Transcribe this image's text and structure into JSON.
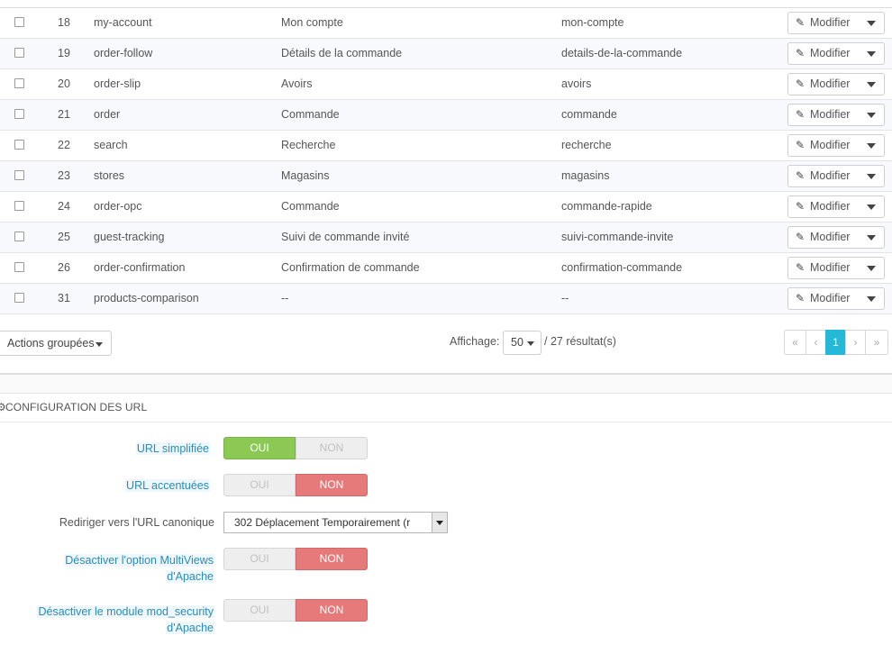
{
  "rows": [
    {
      "id": "18",
      "page": "my-account",
      "title": "Mon compte",
      "url": "mon-compte"
    },
    {
      "id": "19",
      "page": "order-follow",
      "title": "Détails de la commande",
      "url": "details-de-la-commande"
    },
    {
      "id": "20",
      "page": "order-slip",
      "title": "Avoirs",
      "url": "avoirs"
    },
    {
      "id": "21",
      "page": "order",
      "title": "Commande",
      "url": "commande"
    },
    {
      "id": "22",
      "page": "search",
      "title": "Recherche",
      "url": "recherche"
    },
    {
      "id": "23",
      "page": "stores",
      "title": "Magasins",
      "url": "magasins"
    },
    {
      "id": "24",
      "page": "order-opc",
      "title": "Commande",
      "url": "commande-rapide"
    },
    {
      "id": "25",
      "page": "guest-tracking",
      "title": "Suivi de commande invité",
      "url": "suivi-commande-invite"
    },
    {
      "id": "26",
      "page": "order-confirmation",
      "title": "Confirmation de commande",
      "url": "confirmation-commande"
    },
    {
      "id": "31",
      "page": "products-comparison",
      "title": "--",
      "url": "--"
    }
  ],
  "row_action": {
    "edit_label": "Modifier",
    "edit_icon": "pencil-icon",
    "dropdown_icon": "caret-down-icon"
  },
  "footer": {
    "bulk_actions_label": "Actions groupées",
    "display_label": "Affichage:",
    "display_value": "50",
    "results_text": "/ 27 résultat(s)",
    "pagination": {
      "first": "«",
      "prev": "‹",
      "current": "1",
      "next": "›",
      "last": "»"
    }
  },
  "config": {
    "title": "CONFIGURATION DES URL",
    "icon": "cogs-icon",
    "fields": {
      "simplified_url": {
        "label": "URL simplifiée",
        "yes": "OUI",
        "no": "NON",
        "value": "OUI"
      },
      "accented_url": {
        "label": "URL accentuées",
        "yes": "OUI",
        "no": "NON",
        "value": "NON"
      },
      "canonical_redirect": {
        "label": "Rediriger vers l'URL canonique",
        "value": "302 Déplacement Temporairement (r"
      },
      "multiviews": {
        "label_line1": "Désactiver l'option MultiViews",
        "label_line2": "d'Apache",
        "yes": "OUI",
        "no": "NON",
        "value": "NON"
      },
      "mod_security": {
        "label_line1": "Désactiver le module mod_security",
        "label_line2": "d'Apache",
        "yes": "OUI",
        "no": "NON",
        "value": "NON"
      }
    }
  },
  "colors": {
    "accent": "#25b9d7",
    "switch_on": "#8bc954",
    "switch_off": "#e67a7a",
    "hint_text": "#2a8bb8"
  }
}
